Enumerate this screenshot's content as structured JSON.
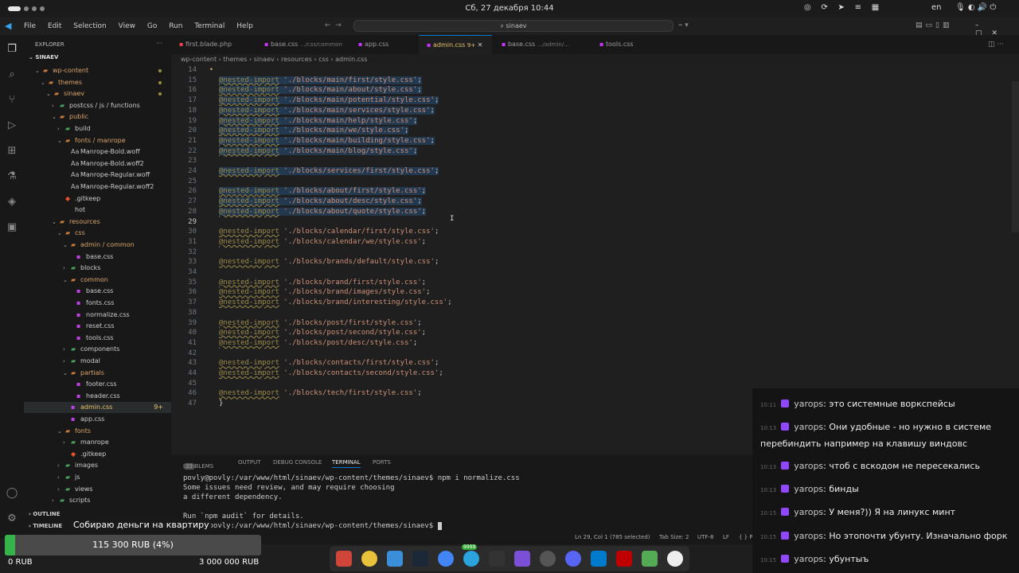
{
  "system": {
    "clock": "Сб, 27 декабря  10:44",
    "lang": "en"
  },
  "vscode": {
    "menu": [
      "File",
      "Edit",
      "Selection",
      "View",
      "Go",
      "Run",
      "Terminal",
      "Help"
    ],
    "command_center": "sinaev",
    "tabs": [
      {
        "label": "first.blade.php",
        "sub": ""
      },
      {
        "label": "base.css",
        "sub": ".../css/common"
      },
      {
        "label": "app.css",
        "sub": ""
      },
      {
        "label": "admin.css",
        "sub": "9+"
      },
      {
        "label": "base.css",
        "sub": ".../admin/..."
      },
      {
        "label": "tools.css",
        "sub": ""
      }
    ],
    "breadcrumbs": "wp-content  ›  themes  ›  sinaev  ›  resources  ›  css  ›  admin.css",
    "explorer": {
      "title": "EXPLORER",
      "root": "SINAEV",
      "items": [
        {
          "label": "wp-content",
          "depth": 0,
          "type": "folder",
          "open": true
        },
        {
          "label": "themes",
          "depth": 1,
          "type": "folder",
          "open": true
        },
        {
          "label": "sinaev",
          "depth": 2,
          "type": "folder",
          "open": true
        },
        {
          "label": "postcss / js / functions",
          "depth": 3,
          "type": "folder",
          "open": false
        },
        {
          "label": "public",
          "depth": 3,
          "type": "folder",
          "open": true
        },
        {
          "label": "build",
          "depth": 4,
          "type": "folder",
          "open": false
        },
        {
          "label": "fonts / manrope",
          "depth": 4,
          "type": "folder",
          "open": true
        },
        {
          "label": "Manrope-Bold.woff",
          "depth": 5,
          "type": "font"
        },
        {
          "label": "Manrope-Bold.woff2",
          "depth": 5,
          "type": "font"
        },
        {
          "label": "Manrope-Regular.woff",
          "depth": 5,
          "type": "font"
        },
        {
          "label": "Manrope-Regular.woff2",
          "depth": 5,
          "type": "font"
        },
        {
          "label": ".gitkeep",
          "depth": 4,
          "type": "git"
        },
        {
          "label": "hot",
          "depth": 4,
          "type": "file"
        },
        {
          "label": "resources",
          "depth": 3,
          "type": "folder",
          "open": true
        },
        {
          "label": "css",
          "depth": 4,
          "type": "folder",
          "open": true
        },
        {
          "label": "admin / common",
          "depth": 5,
          "type": "folder",
          "open": true
        },
        {
          "label": "base.css",
          "depth": 6,
          "type": "css"
        },
        {
          "label": "blocks",
          "depth": 5,
          "type": "folder",
          "open": false
        },
        {
          "label": "common",
          "depth": 5,
          "type": "folder",
          "open": true
        },
        {
          "label": "base.css",
          "depth": 6,
          "type": "css"
        },
        {
          "label": "fonts.css",
          "depth": 6,
          "type": "css"
        },
        {
          "label": "normalize.css",
          "depth": 6,
          "type": "css"
        },
        {
          "label": "reset.css",
          "depth": 6,
          "type": "css"
        },
        {
          "label": "tools.css",
          "depth": 6,
          "type": "css"
        },
        {
          "label": "components",
          "depth": 5,
          "type": "folder",
          "open": false
        },
        {
          "label": "modal",
          "depth": 5,
          "type": "folder",
          "open": false
        },
        {
          "label": "partials",
          "depth": 5,
          "type": "folder",
          "open": true
        },
        {
          "label": "footer.css",
          "depth": 6,
          "type": "css"
        },
        {
          "label": "header.css",
          "depth": 6,
          "type": "css"
        },
        {
          "label": "admin.css",
          "depth": 5,
          "type": "css",
          "badge": "9+"
        },
        {
          "label": "app.css",
          "depth": 5,
          "type": "css"
        },
        {
          "label": "fonts",
          "depth": 4,
          "type": "folder",
          "open": true
        },
        {
          "label": "manrope",
          "depth": 5,
          "type": "folder",
          "open": false
        },
        {
          "label": ".gitkeep",
          "depth": 5,
          "type": "git"
        },
        {
          "label": "images",
          "depth": 4,
          "type": "folder",
          "open": false
        },
        {
          "label": "js",
          "depth": 4,
          "type": "folder",
          "open": false
        },
        {
          "label": "views",
          "depth": 4,
          "type": "folder",
          "open": false
        },
        {
          "label": "scripts",
          "depth": 3,
          "type": "folder",
          "open": false
        }
      ],
      "outline": "OUTLINE",
      "timeline": "TIMELINE"
    },
    "code": [
      {
        "n": "14",
        "s": "",
        "p": "",
        "x": ""
      },
      {
        "n": "15",
        "s": "@nested-import",
        "p": "'./blocks/main/first/style.css'",
        "x": ";"
      },
      {
        "n": "16",
        "s": "@nested-import",
        "p": "'./blocks/main/about/style.css'",
        "x": ";"
      },
      {
        "n": "17",
        "s": "@nested-import",
        "p": "'./blocks/main/potential/style.css'",
        "x": ";"
      },
      {
        "n": "18",
        "s": "@nested-import",
        "p": "'./blocks/main/services/style.css'",
        "x": ";"
      },
      {
        "n": "19",
        "s": "@nested-import",
        "p": "'./blocks/main/help/style.css'",
        "x": ";"
      },
      {
        "n": "20",
        "s": "@nested-import",
        "p": "'./blocks/main/we/style.css'",
        "x": ";"
      },
      {
        "n": "21",
        "s": "@nested-import",
        "p": "'./blocks/main/building/style.css'",
        "x": ";"
      },
      {
        "n": "22",
        "s": "@nested-import",
        "p": "'./blocks/main/blog/style.css'",
        "x": ";"
      },
      {
        "n": "23",
        "s": "",
        "p": "",
        "x": ""
      },
      {
        "n": "24",
        "s": "@nested-import",
        "p": "'./blocks/services/first/style.css'",
        "x": ";"
      },
      {
        "n": "25",
        "s": "",
        "p": "",
        "x": ""
      },
      {
        "n": "26",
        "s": "@nested-import",
        "p": "'./blocks/about/first/style.css'",
        "x": ";"
      },
      {
        "n": "27",
        "s": "@nested-import",
        "p": "'./blocks/about/desc/style.css'",
        "x": ";"
      },
      {
        "n": "28",
        "s": "@nested-import",
        "p": "'./blocks/about/quote/style.css'",
        "x": ";"
      },
      {
        "n": "29",
        "s": "",
        "p": "",
        "x": ""
      },
      {
        "n": "30",
        "s": "@nested-import",
        "p": "'./blocks/calendar/first/style.css'",
        "x": ";"
      },
      {
        "n": "31",
        "s": "@nested-import",
        "p": "'./blocks/calendar/we/style.css'",
        "x": ";"
      },
      {
        "n": "32",
        "s": "",
        "p": "",
        "x": ""
      },
      {
        "n": "33",
        "s": "@nested-import",
        "p": "'./blocks/brands/default/style.css'",
        "x": ";"
      },
      {
        "n": "34",
        "s": "",
        "p": "",
        "x": ""
      },
      {
        "n": "35",
        "s": "@nested-import",
        "p": "'./blocks/brand/first/style.css'",
        "x": ";"
      },
      {
        "n": "36",
        "s": "@nested-import",
        "p": "'./blocks/brand/images/style.css'",
        "x": ";"
      },
      {
        "n": "37",
        "s": "@nested-import",
        "p": "'./blocks/brand/interesting/style.css'",
        "x": ";"
      },
      {
        "n": "38",
        "s": "",
        "p": "",
        "x": ""
      },
      {
        "n": "39",
        "s": "@nested-import",
        "p": "'./blocks/post/first/style.css'",
        "x": ";"
      },
      {
        "n": "40",
        "s": "@nested-import",
        "p": "'./blocks/post/second/style.css'",
        "x": ";"
      },
      {
        "n": "41",
        "s": "@nested-import",
        "p": "'./blocks/post/desc/style.css'",
        "x": ";"
      },
      {
        "n": "42",
        "s": "",
        "p": "",
        "x": ""
      },
      {
        "n": "43",
        "s": "@nested-import",
        "p": "'./blocks/contacts/first/style.css'",
        "x": ";"
      },
      {
        "n": "44",
        "s": "@nested-import",
        "p": "'./blocks/contacts/second/style.css'",
        "x": ";"
      },
      {
        "n": "45",
        "s": "",
        "p": "",
        "x": ""
      },
      {
        "n": "46",
        "s": "@nested-import",
        "p": "'./blocks/tech/first/style.css'",
        "x": ";"
      },
      {
        "n": "47",
        "s": "}",
        "p": "",
        "x": ""
      }
    ],
    "panel": {
      "tabs": [
        "PROBLEMS",
        "OUTPUT",
        "DEBUG CONSOLE",
        "TERMINAL",
        "PORTS"
      ],
      "problems_count": "33",
      "lines": [
        "povly@povly:/var/www/html/sinaev/wp-content/themes/sinaev$ npm i normalize.css",
        "Some issues need review, and may require choosing",
        "a different dependency.",
        "",
        "Run `npm audit` for details.",
        "povly@povly:/var/www/html/sinaev/wp-content/themes/sinaev$ "
      ]
    },
    "status": {
      "position": "Ln 29, Col 1 (785 selected)",
      "tab": "Tab Size: 2",
      "enc": "UTF-8",
      "eol": "LF",
      "lang": "{ }  P"
    }
  },
  "chat": [
    {
      "time": "10:11",
      "user": "yarops",
      "text": "это системные воркспейсы"
    },
    {
      "time": "10:13",
      "user": "yarops",
      "text": "Они удобные - но нужно в системе перебиндить например на клавишу виндовс"
    },
    {
      "time": "10:13",
      "user": "yarops",
      "text": "чтоб с вскодом не пересекались"
    },
    {
      "time": "10:13",
      "user": "yarops",
      "text": "бинды"
    },
    {
      "time": "10:15",
      "user": "yarops",
      "text": "У меня?)) Я на линукс минт"
    },
    {
      "time": "10:15",
      "user": "yarops",
      "text": "Но этопочти убунту. Изначально форк"
    },
    {
      "time": "10:15",
      "user": "yarops",
      "text": "убунтыъ"
    }
  ],
  "donation": {
    "title": "Собираю деньги на квартиру",
    "progress_text": "115 300 RUB (4%)",
    "progress": 0.04,
    "min": "0 RUB",
    "max": "3 000 000 RUB"
  },
  "dock": {
    "badge": "9999"
  }
}
